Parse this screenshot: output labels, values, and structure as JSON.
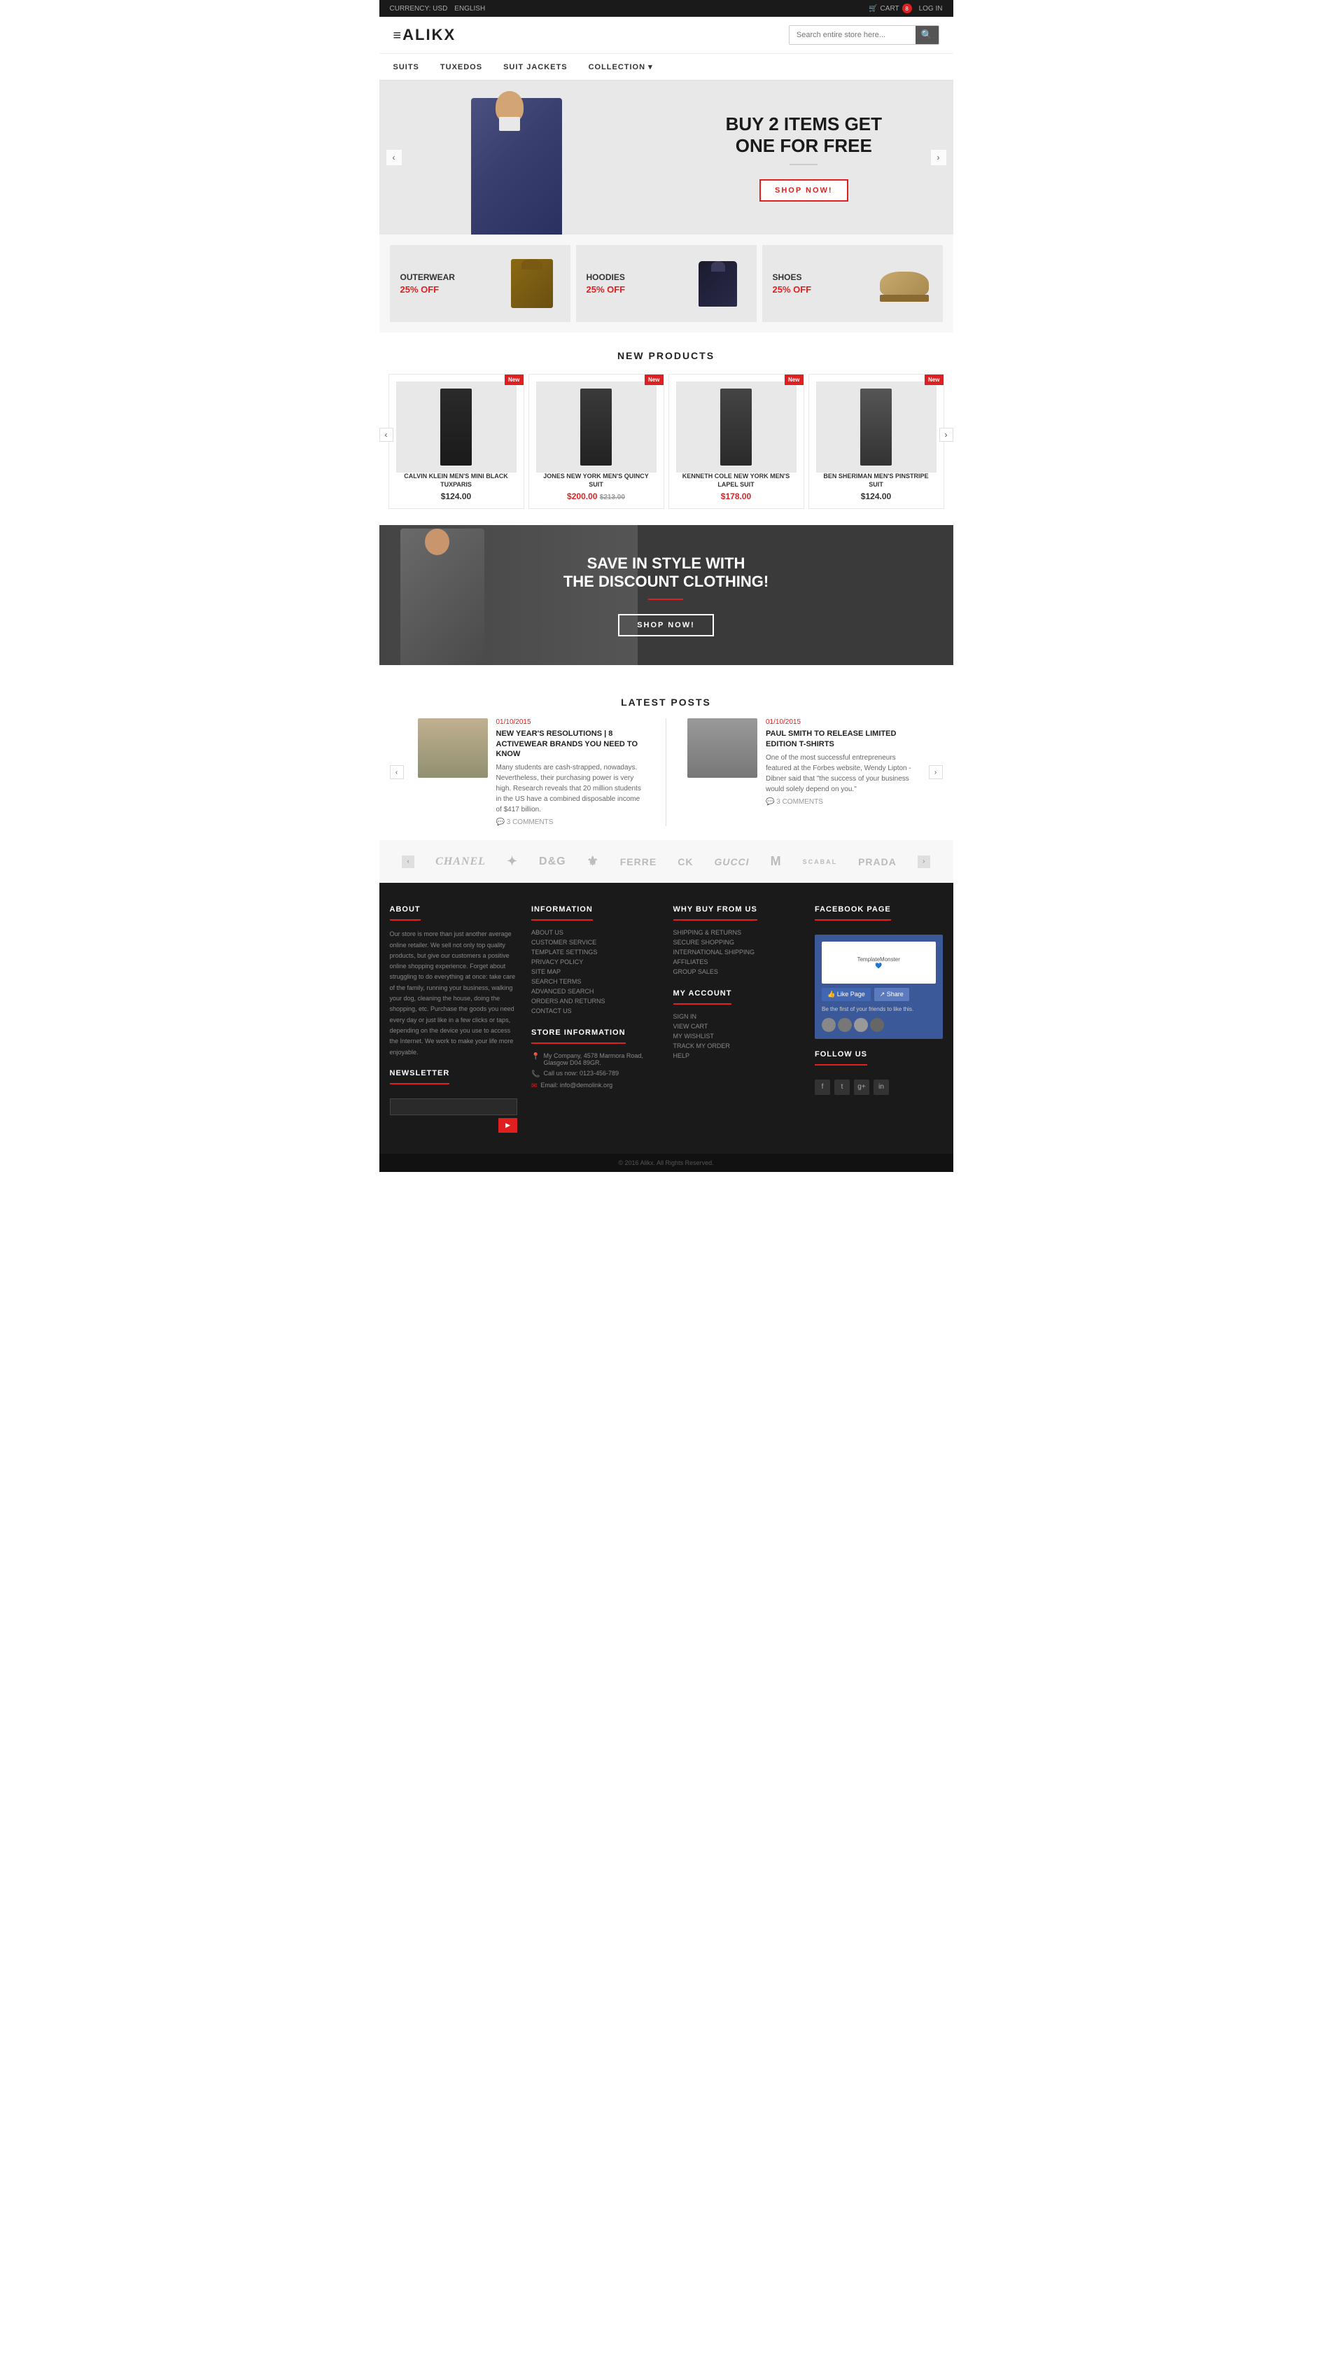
{
  "topbar": {
    "currency_label": "CURRENCY: USD",
    "language_label": "ENGLISH",
    "cart_label": "CART",
    "cart_count": "8",
    "login_label": "LOG IN"
  },
  "header": {
    "logo": "ALIKX",
    "logo_prefix": "≡",
    "search_placeholder": "Search entire store here..."
  },
  "nav": {
    "items": [
      {
        "label": "SUITS"
      },
      {
        "label": "TUXEDOS"
      },
      {
        "label": "SUIT JACKETS"
      },
      {
        "label": "COLLECTION ▾"
      }
    ]
  },
  "hero": {
    "line1": "BUY 2 ITEMS GET",
    "line2": "ONE FOR FREE",
    "cta": "SHOP NOW!",
    "arrow_left": "‹",
    "arrow_right": "›"
  },
  "promo": {
    "cards": [
      {
        "category": "OUTERWEAR",
        "discount": "25% OFF"
      },
      {
        "category": "HOODIES",
        "discount": "25% OFF"
      },
      {
        "category": "SHOES",
        "discount": "25% OFF"
      }
    ]
  },
  "new_products": {
    "section_title": "NEW PRODUCTS",
    "badge": "New",
    "products": [
      {
        "name": "CALVIN KLEIN MEN'S MINI BLACK TUXPARIS",
        "price": "$124.00",
        "old_price": null,
        "sale_price": null
      },
      {
        "name": "JONES NEW YORK MEN'S QUINCY SUIT",
        "price": "$213.00",
        "old_price": "$213.00",
        "sale_price": "$200.00"
      },
      {
        "name": "KENNETH COLE NEW YORK MEN'S LAPEL SUIT",
        "price": null,
        "old_price": null,
        "sale_price": "$178.00"
      },
      {
        "name": "BEN SHERIMAN MEN'S PINSTRIPE SUIT",
        "price": "$124.00",
        "old_price": null,
        "sale_price": null
      }
    ],
    "arrow_left": "‹",
    "arrow_right": "›"
  },
  "banner2": {
    "line1": "SAVE IN STYLE WITH",
    "line2": "THE DISCOUNT CLOTHING!",
    "cta": "SHOP NOW!"
  },
  "blog": {
    "section_title": "LATEST POSTS",
    "posts": [
      {
        "date": "01/10/2015",
        "title": "NEW YEAR'S RESOLUTIONS | 8 ACTIVEWEAR BRANDS YOU NEED TO KNOW",
        "excerpt": "Many students are cash-strapped, nowadays. Nevertheless, their purchasing power is very high. Research reveals that 20 million students in the US have a combined disposable income of $417 billion.",
        "comments": "3 COMMENTS"
      },
      {
        "date": "01/10/2015",
        "title": "PAUL SMITH TO RELEASE LIMITED EDITION T-SHIRTS",
        "excerpt": "One of the most successful entrepreneurs featured at the Forbes website, Wendy Lipton - Dibner said that \"the success of your business would solely depend on you.\"",
        "comments": "3 COMMENTS"
      }
    ],
    "arrow_left": "‹",
    "arrow_right": "›"
  },
  "brands": {
    "items": [
      {
        "name": "CHANEL",
        "style": "serif"
      },
      {
        "name": "✦",
        "style": "icon"
      },
      {
        "name": "D&G",
        "style": "normal"
      },
      {
        "name": "⚜",
        "style": "icon"
      },
      {
        "name": "FERRE",
        "style": "normal"
      },
      {
        "name": "CK",
        "style": "normal"
      },
      {
        "name": "GUCCI",
        "style": "normal"
      },
      {
        "name": "M",
        "style": "bold"
      },
      {
        "name": "SCABAL",
        "style": "normal"
      },
      {
        "name": "PRADA",
        "style": "normal"
      }
    ],
    "arrow_left": "‹",
    "arrow_right": "›"
  },
  "footer": {
    "about": {
      "title": "ABOUT",
      "text": "Our store is more than just another average online retailer. We sell not only top quality products, but give our customers a positive online shopping experience. Forget about struggling to do everything at once: take care of the family, running your business, walking your dog, cleaning the house, doing the shopping, etc. Purchase the goods you need every day or just like in a few clicks or taps, depending on the device you use to access the Internet. We work to make your life more enjoyable."
    },
    "newsletter": {
      "title": "NEWSLETTER",
      "placeholder": ""
    },
    "information": {
      "title": "INFORMATION",
      "links": [
        "ABOUT US",
        "CUSTOMER SERVICE",
        "TEMPLATE SETTINGS",
        "PRIVACY POLICY",
        "SITE MAP",
        "SEARCH TERMS",
        "ADVANCED SEARCH",
        "ORDERS AND RETURNS",
        "CONTACT US"
      ],
      "store_title": "STORE INFORMATION",
      "address": "My Company, 4578 Marmora Road, Glasgow D04 89GR.",
      "phone": "Call us now: 0123-456-789",
      "email": "Email: info@demolink.org"
    },
    "why_buy": {
      "title": "WHY BUY FROM US",
      "links": [
        "SHIPPING & RETURNS",
        "SECURE SHOPPING",
        "INTERNATIONAL SHIPPING",
        "AFFILIATES",
        "GROUP SALES"
      ]
    },
    "my_account": {
      "title": "MY ACCOUNT",
      "links": [
        "SIGN IN",
        "VIEW CART",
        "MY WISHLIST",
        "TRACK MY ORDER",
        "HELP"
      ]
    },
    "facebook": {
      "title": "FACEBOOK PAGE",
      "like_label": "Like Page",
      "share_label": "Share",
      "desc": "Be the first of your friends to like this."
    },
    "follow": {
      "title": "FOLLOW US",
      "icons": [
        "f",
        "t",
        "g+",
        "in"
      ]
    },
    "copyright": "© 2016 Alikx. All Rights Reserved."
  }
}
